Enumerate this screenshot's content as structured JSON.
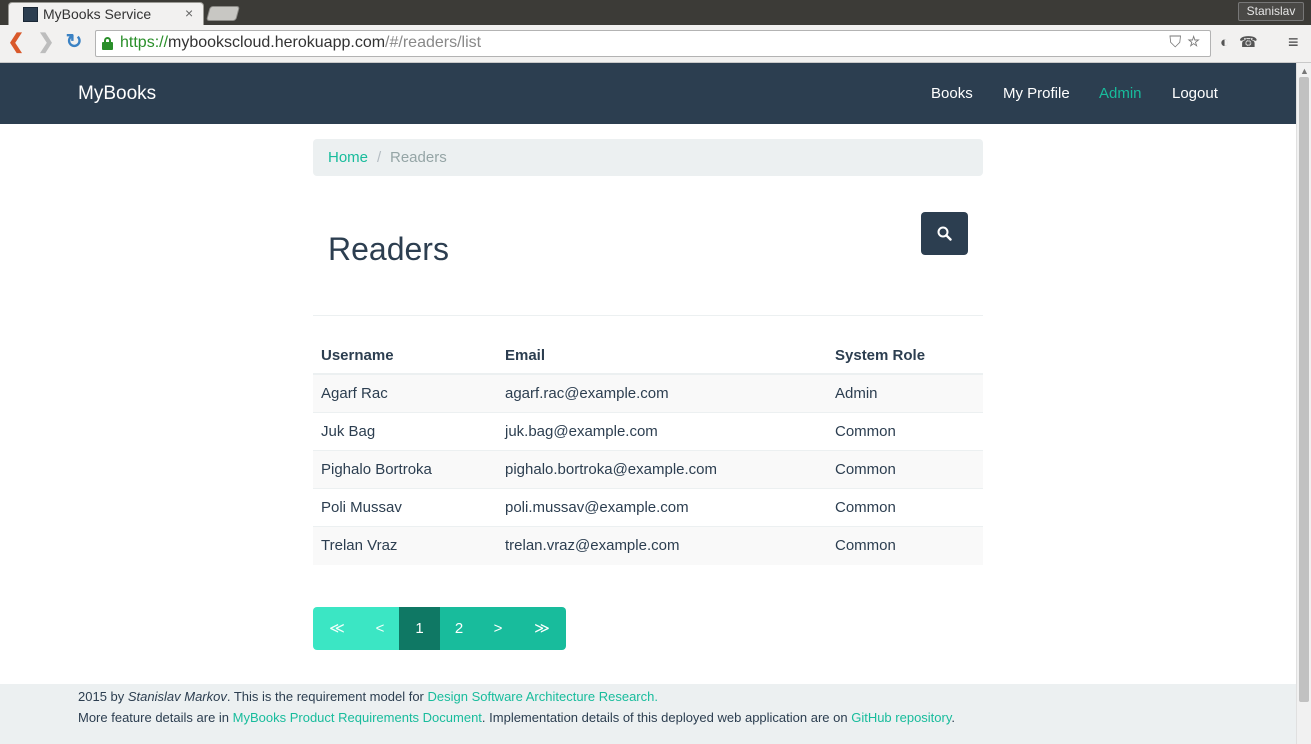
{
  "browser": {
    "tab_title": "MyBooks Service",
    "tab_close": "×",
    "profile_name": "Stanislav",
    "url_scheme": "https://",
    "url_host": "mybookscloud.herokuapp.com",
    "url_path": "/#/readers/list"
  },
  "navbar": {
    "brand": "MyBooks",
    "links": [
      {
        "label": "Books"
      },
      {
        "label": "My Profile"
      },
      {
        "label": "Admin",
        "active": true
      },
      {
        "label": "Logout"
      }
    ]
  },
  "breadcrumb": {
    "home": "Home",
    "separator": "/",
    "current": "Readers"
  },
  "page": {
    "title": "Readers",
    "search_icon": "search-icon"
  },
  "table": {
    "headers": [
      "Username",
      "Email",
      "System Role"
    ],
    "rows": [
      [
        "Agarf Rac",
        "agarf.rac@example.com",
        "Admin"
      ],
      [
        "Juk Bag",
        "juk.bag@example.com",
        "Common"
      ],
      [
        "Pighalo Bortroka",
        "pighalo.bortroka@example.com",
        "Common"
      ],
      [
        "Poli Mussav",
        "poli.mussav@example.com",
        "Common"
      ],
      [
        "Trelan Vraz",
        "trelan.vraz@example.com",
        "Common"
      ]
    ]
  },
  "pagination": {
    "first": "≪",
    "prev": "<",
    "pages": [
      "1",
      "2"
    ],
    "current_page": "1",
    "next": ">",
    "last": "≫"
  },
  "footer": {
    "line1_year_by": "2015 by ",
    "line1_author": "Stanislav Markov",
    "line1_text": ". This is the requirement model for ",
    "line1_link": "Design Software Architecture Research.",
    "line2_text_a": "More feature details are in ",
    "line2_link_a": "MyBooks Product Requirements Document",
    "line2_text_b": ". Implementation details of this deployed web application are on ",
    "line2_link_b": "GitHub repository",
    "line2_text_c": "."
  },
  "colors": {
    "navbar_bg": "#2c3e50",
    "accent": "#18bc9c",
    "breadcrumb_bg": "#ecf0f1"
  }
}
